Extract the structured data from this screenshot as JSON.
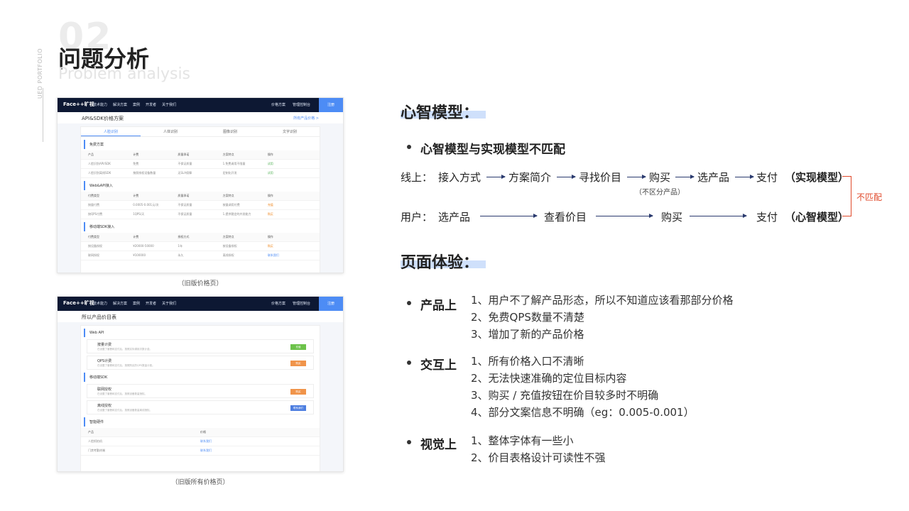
{
  "header": {
    "number": "02",
    "title": "问题分析",
    "subtitle": "Problem analysis",
    "side_text": "UED PORTFOLIO"
  },
  "shot1": {
    "logo": "Face++旷视",
    "nav": [
      "技术能力",
      "解决方案",
      "案例",
      "开发者",
      "关于我们"
    ],
    "right": [
      "价格方案",
      "管理控制台"
    ],
    "cta": "注册",
    "page_title": "API&SDK价格方案",
    "page_link": "所有产品价格 >",
    "tabs": [
      "人脸识别",
      "人体识别",
      "图像识别",
      "文字识别"
    ],
    "sections": [
      {
        "title": "免费方案",
        "header": [
          "产品",
          "计费",
          "质量承诺",
          "方案特点",
          "操作"
        ],
        "rows": [
          [
            "人脸识别API/SDK",
            "免费",
            "不保证质量",
            "1.免费调用不限量",
            "试用"
          ],
          [
            "人脸识别离线SDK",
            "按照授权设备数量",
            "无SLA保障",
            "定制化开发",
            "试用"
          ]
        ]
      },
      {
        "title": "Web&API接入",
        "header": [
          "付费类型",
          "计费",
          "质量承诺",
          "方案特点",
          "操作"
        ],
        "rows": [
          [
            "按量付费",
            "0.0005-0.001元/次",
            "不保证质量",
            "按量调用付费",
            "充值"
          ],
          [
            "按QPS付费",
            "1QPS/天",
            "不保证质量",
            "1.提供稳定的并发能力",
            "购买"
          ]
        ]
      },
      {
        "title": "移动端SDK接入",
        "header": [
          "付费类型",
          "计费",
          "授权方式",
          "方案特点",
          "操作"
        ],
        "rows": [
          [
            "按设备授权",
            "¥20000-50000",
            "1年",
            "按设备授权",
            "购买"
          ],
          [
            "联网授权",
            "¥100000",
            "永久",
            "离线授权",
            "联系我们"
          ]
        ]
      }
    ],
    "caption": "（旧版价格页）"
  },
  "shot2": {
    "logo": "Face++旷视",
    "nav": [
      "技术能力",
      "解决方案",
      "案例",
      "开发者",
      "关于我们"
    ],
    "right": [
      "价格方案",
      "管理控制台"
    ],
    "cta": "注册",
    "page_title": "所以产品价目表",
    "sections": [
      {
        "title": "Web API",
        "cards": [
          {
            "name": "按量计费",
            "desc": "在设置了套餐和支付后，按照实际调用次数计费。",
            "btn": "充值",
            "color": "#6cc24a"
          },
          {
            "name": "QPS计费",
            "desc": "在设置了套餐和支付后，按照购买的QPS数量计费。",
            "btn": "购买",
            "color": "#f0944a"
          }
        ]
      },
      {
        "title": "移动端SDK",
        "cards": [
          {
            "name": "联网授权",
            "desc": "在设置了套餐和支付后，按照设备数量授权。",
            "btn": "购买",
            "color": "#f0944a"
          },
          {
            "name": "离线授权",
            "desc": "在设置了套餐和支付后，按照设备数量离线授权。",
            "btn": "联系我们",
            "color": "#4d7ee0"
          }
        ]
      },
      {
        "title": "智能硬件",
        "header": [
          "产品",
          "价格"
        ],
        "rows": [
          [
            "人脸抓拍机",
            "联系我们"
          ],
          [
            "门禁考勤终端",
            "联系我们"
          ]
        ]
      }
    ],
    "caption": "（旧版所有价格页）"
  },
  "right": {
    "mental_model_title": "心智模型：",
    "mismatch_point": "心智模型与实现模型不匹配",
    "online_label": "线上：",
    "online_steps": [
      "接入方式",
      "方案简介",
      "寻找价目",
      "购买",
      "选产品",
      "支付"
    ],
    "online_note": "（不区分产品）",
    "online_model": "（实现模型）",
    "user_label": "用户：",
    "user_steps": [
      "选产品",
      "查看价目",
      "购买",
      "支付"
    ],
    "user_model": "（心智模型）",
    "mismatch_tag": "不匹配",
    "page_exp_title": "页面体验：",
    "groups": [
      {
        "label": "产品上",
        "items": [
          "1、用户不了解产品形态，所以不知道应该看那部分价格",
          "2、免费QPS数量不清楚",
          "3、增加了新的产品价格"
        ]
      },
      {
        "label": "交互上",
        "items": [
          "1、所有价格入口不清晰",
          "2、无法快速准确的定位目标内容",
          "3、购买 / 充值按钮在价目较多时不明确",
          "4、部分文案信息不明确（eg：0.005-0.001）"
        ]
      },
      {
        "label": "视觉上",
        "items": [
          "1、整体字体有一些小",
          "2、价目表格设计可读性不强"
        ]
      }
    ]
  },
  "colors": {
    "accent": "#4d8cf5",
    "highlight": "#cfe0fb",
    "mismatch": "#e04a2b",
    "arrow": "#2a3a6e"
  }
}
